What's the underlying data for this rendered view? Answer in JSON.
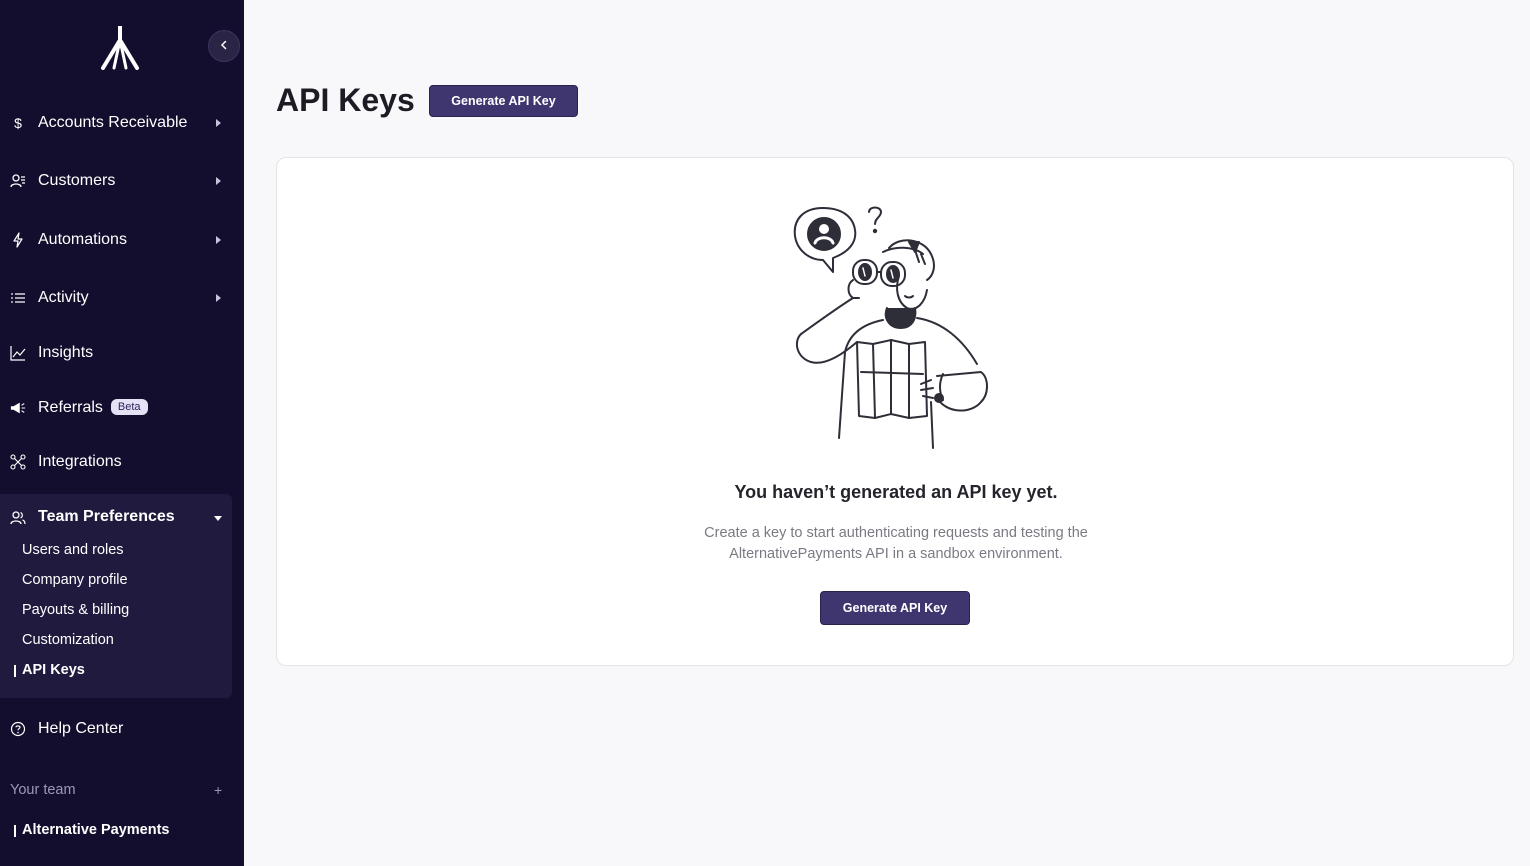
{
  "sidebar": {
    "logo": "alternative-payments-logo",
    "collapse_icon": "chevron-left-icon",
    "items": [
      {
        "label": "Accounts Receivable",
        "icon": "dollar-icon",
        "expandable": true
      },
      {
        "label": "Customers",
        "icon": "customers-icon",
        "expandable": true
      },
      {
        "label": "Automations",
        "icon": "lightning-icon",
        "expandable": true
      },
      {
        "label": "Activity",
        "icon": "list-icon",
        "expandable": true
      },
      {
        "label": "Insights",
        "icon": "chart-line-icon",
        "expandable": false
      },
      {
        "label": "Referrals",
        "icon": "megaphone-icon",
        "badge": "Beta",
        "expandable": false
      },
      {
        "label": "Integrations",
        "icon": "integrations-icon",
        "expandable": false
      }
    ],
    "team_preferences": {
      "label": "Team Preferences",
      "icon": "team-icon",
      "expanded": true,
      "sub_items": [
        "Users and roles",
        "Company profile",
        "Payouts & billing",
        "Customization",
        "API Keys"
      ],
      "active": "API Keys"
    },
    "help_center": {
      "label": "Help Center",
      "icon": "help-circle-icon"
    },
    "your_team": {
      "label": "Your team",
      "add_icon": "+",
      "team_name": "Alternative Payments"
    }
  },
  "main": {
    "title": "API Keys",
    "generate_button": "Generate API Key",
    "empty_state": {
      "illustration": "explorer-binoculars-illustration",
      "title": "You haven’t generated an API key yet.",
      "description": "Create a key to start authenticating requests and testing the AlternativePayments API in a sandbox environment.",
      "button": "Generate API Key"
    }
  },
  "colors": {
    "sidebar_bg": "#130e2e",
    "sidebar_group_bg": "#201a3e",
    "primary_button": "#3f3670",
    "page_bg": "#f8f8fa"
  }
}
